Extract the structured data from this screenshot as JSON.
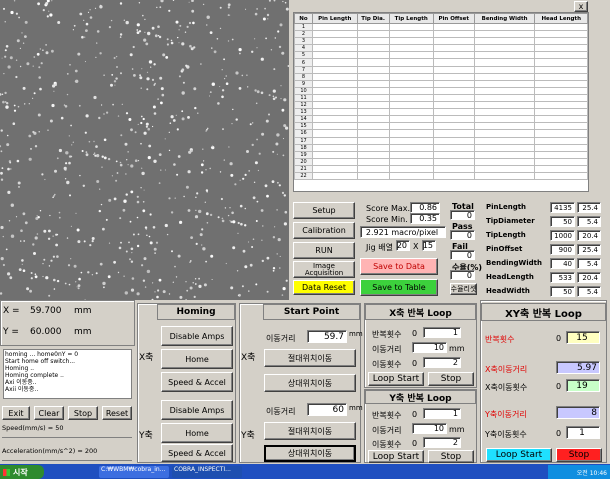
{
  "table": {
    "close_label": "x",
    "headers": [
      "No",
      "Pin Length",
      "Tip Dia.",
      "Tip Length",
      "Pin Offset",
      "Bending Width",
      "Head Length"
    ],
    "rows": [
      "1",
      "2",
      "3",
      "4",
      "5",
      "6",
      "7",
      "8",
      "9",
      "10",
      "11",
      "12",
      "13",
      "14",
      "15",
      "16",
      "17",
      "18",
      "19",
      "20",
      "21",
      "22"
    ]
  },
  "controls": {
    "setup": "Setup",
    "calibration": "Calibration",
    "run": "RUN",
    "image_acq": "Image Acquisition",
    "data_reset": "Data Reset",
    "score_max_label": "Score Max.",
    "score_max": "0.86",
    "score_min_label": "Score Min.",
    "score_min": "0.35",
    "macro_pixel": "2.921  macro/pixel",
    "jig_label": "Jig 배열",
    "jig_x": "20",
    "jig_mid": "X",
    "jig_y": "15",
    "save_data": "Save to Data",
    "save_table": "Save to Table",
    "total_label": "Total",
    "total": "0",
    "pass_label": "Pass",
    "pass": "0",
    "fail_label": "Fail",
    "fail": "0",
    "yield_label": "수율(%)",
    "yield": "0",
    "yield_reset": "수율리셋"
  },
  "results": [
    {
      "name": "PinLength",
      "v1": "4135",
      "v2": "25.4"
    },
    {
      "name": "TipDiameter",
      "v1": "50",
      "v2": "5.4"
    },
    {
      "name": "TipLength",
      "v1": "1000",
      "v2": "20.4"
    },
    {
      "name": "PinOffset",
      "v1": "900",
      "v2": "25.4"
    },
    {
      "name": "BendingWidth",
      "v1": "40",
      "v2": "5.4"
    },
    {
      "name": "HeadLength",
      "v1": "533",
      "v2": "20.4"
    },
    {
      "name": "HeadWidth",
      "v1": "50",
      "v2": "5.4"
    }
  ],
  "position": {
    "x_label": "X =",
    "x_value": "59.700",
    "x_unit": "mm",
    "y_label": "Y =",
    "y_value": "60.000",
    "y_unit": "mm"
  },
  "log": [
    "homing ... home0nY = 0",
    "Start home off switch...",
    "Homing ..",
    "Homing complete ..",
    "Axi 이동중..",
    "Axii 이동중.."
  ],
  "left_buttons": {
    "exit": "Exit",
    "clear": "Clear",
    "stop": "Stop",
    "reset": "Reset"
  },
  "speed_label": "Speed(mm/s) = 50",
  "accel_label": "Acceleration(mm/s^2) = 200",
  "homing": {
    "title": "Homing",
    "x_axis": "X축",
    "y_axis": "Y축",
    "disable_amps": "Disable Amps",
    "home": "Home",
    "speed_accel": "Speed & Accel"
  },
  "start_point": {
    "title": "Start Point",
    "x_axis": "X축",
    "y_axis": "Y축",
    "move_dist_label": "이동거리",
    "x_dist": "59.7",
    "y_dist": "60",
    "unit": "mm",
    "abs_move": "절대위치이동",
    "rel_move": "상대위치이동"
  },
  "x_loop": {
    "title": "X축 반복 Loop",
    "repeat_label": "반복횟수",
    "repeat_left": "0",
    "repeat": "1",
    "dist_label": "이동거리",
    "dist": "10",
    "unit": "mm",
    "count_label": "이동횟수",
    "count_left": "0",
    "count": "2",
    "loop_start": "Loop Start",
    "stop": "Stop"
  },
  "y_loop": {
    "title": "Y축 반복 Loop",
    "repeat_label": "반복횟수",
    "repeat_left": "0",
    "repeat": "1",
    "dist_label": "이동거리",
    "dist": "10",
    "unit": "mm",
    "count_label": "이동횟수",
    "count_left": "0",
    "count": "2",
    "loop_start": "Loop Start",
    "stop": "Stop"
  },
  "xy_loop": {
    "title": "XY축 반복 Loop",
    "repeat_label": "반복횟수",
    "repeat_left": "0",
    "repeat": "15",
    "x_dist_label": "X축이동거리",
    "x_dist": "5.97",
    "x_count_label": "X축이동횟수",
    "x_count_left": "0",
    "x_count": "19",
    "y_dist_label": "Y축이동거리",
    "y_dist": "8",
    "y_count_label": "Y축이동횟수",
    "y_count_left": "0",
    "y_count": "1",
    "loop_start": "Loop Start",
    "stop": "Stop"
  },
  "taskbar": {
    "start": "시작",
    "tasks": [
      "C:₩WBM₩cobra_in...",
      "COBRA_INSPECTI..."
    ],
    "clock": "오전 10:46"
  },
  "colors": {
    "pink": "#ffb4b4",
    "green": "#3cd13c",
    "yellow": "#ffff00",
    "blue_btn": "#1fe0ff",
    "red_btn": "#ff2020",
    "yellow_field": "#ffffc0",
    "violet_field": "#c8c8ff",
    "green_field": "#c8ffc8",
    "red_text": "#e00000"
  }
}
